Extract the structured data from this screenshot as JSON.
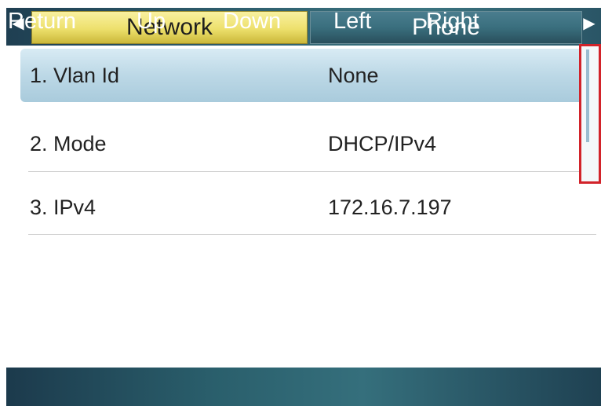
{
  "tabs": {
    "left_arrow": "◀",
    "right_arrow": "▶",
    "items": [
      {
        "label": "Network",
        "active": true
      },
      {
        "label": "Phone",
        "active": false
      }
    ]
  },
  "list": {
    "rows": [
      {
        "label": "1. Vlan Id",
        "value": "None",
        "selected": true
      },
      {
        "label": "2. Mode",
        "value": "DHCP/IPv4",
        "selected": false
      },
      {
        "label": "3. IPv4",
        "value": "172.16.7.197",
        "selected": false
      }
    ]
  },
  "softkeys": [
    "Return",
    "Up",
    "Down",
    "Left",
    "Right"
  ],
  "colors": {
    "active_tab": "#ede06c",
    "inactive_tab": "#3a6f7e",
    "selected_row": "#bcd8e6",
    "highlight_box": "#d2232a"
  }
}
